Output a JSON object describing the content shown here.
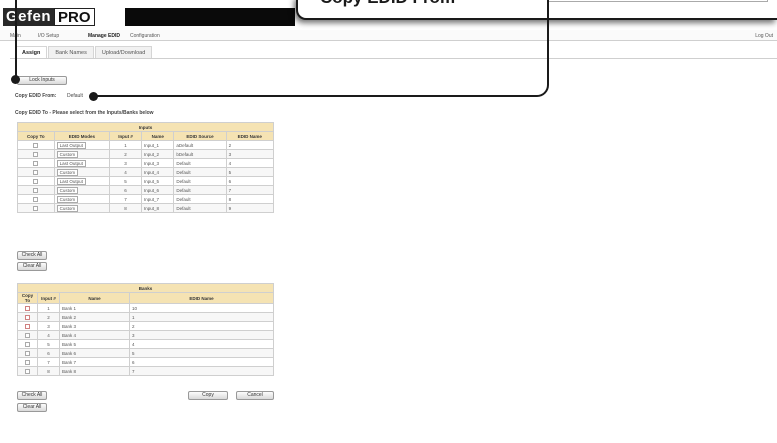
{
  "header": {
    "logo_left": "Gefen",
    "logo_right": "PRO"
  },
  "callout": {
    "title": "Copy EDID From"
  },
  "topnav": {
    "items": [
      "Main",
      "I/O Setup",
      "Manage EDID",
      "Configuration"
    ],
    "logout": "Log Out"
  },
  "subtabs": [
    "Assign",
    "Bank Names",
    "Upload/Download"
  ],
  "buttons": {
    "top_button": "Lock Inputs",
    "check_all": "Check All",
    "clear_all": "Clear All",
    "check_all_2": "Check All",
    "clear_all_2": "Clear All",
    "copy": "Copy",
    "cancel": "Cancel"
  },
  "copy_from": {
    "label": "Copy EDID From:",
    "value": "Default"
  },
  "copy_to": {
    "label": "Copy EDID To - Please select from the Inputs/Banks below"
  },
  "inputs_table": {
    "title": "Inputs",
    "columns": [
      "Copy To",
      "EDID Modes",
      "Input #",
      "Name",
      "EDID Source",
      "EDID Name"
    ],
    "rows": [
      {
        "mode": "Last Output",
        "num": "1",
        "name": "Input_1",
        "source": "aDefault",
        "edid_name": "2"
      },
      {
        "mode": "Custom",
        "num": "2",
        "name": "Input_2",
        "source": "bDefault",
        "edid_name": "3"
      },
      {
        "mode": "Last Output",
        "num": "3",
        "name": "Input_3",
        "source": "Default",
        "edid_name": "4"
      },
      {
        "mode": "Custom",
        "num": "4",
        "name": "Input_4",
        "source": "Default",
        "edid_name": "5"
      },
      {
        "mode": "Last Output",
        "num": "5",
        "name": "Input_5",
        "source": "Default",
        "edid_name": "6"
      },
      {
        "mode": "Custom",
        "num": "6",
        "name": "Input_6",
        "source": "Default",
        "edid_name": "7"
      },
      {
        "mode": "Custom",
        "num": "7",
        "name": "Input_7",
        "source": "Default",
        "edid_name": "8"
      },
      {
        "mode": "Custom",
        "num": "8",
        "name": "Input_8",
        "source": "Default",
        "edid_name": "9"
      }
    ]
  },
  "banks_table": {
    "title": "Banks",
    "columns": [
      "Copy To",
      "Input #",
      "Name",
      "EDID Name"
    ],
    "rows": [
      {
        "num": "1",
        "name": "Bank 1",
        "edid_name": "10"
      },
      {
        "num": "2",
        "name": "Bank 2",
        "edid_name": "1"
      },
      {
        "num": "3",
        "name": "Bank 3",
        "edid_name": "2"
      },
      {
        "num": "4",
        "name": "Bank 4",
        "edid_name": "3"
      },
      {
        "num": "5",
        "name": "Bank 5",
        "edid_name": "4"
      },
      {
        "num": "6",
        "name": "Bank 6",
        "edid_name": "5"
      },
      {
        "num": "7",
        "name": "Bank 7",
        "edid_name": "6"
      },
      {
        "num": "8",
        "name": "Bank 8",
        "edid_name": "7"
      }
    ]
  }
}
